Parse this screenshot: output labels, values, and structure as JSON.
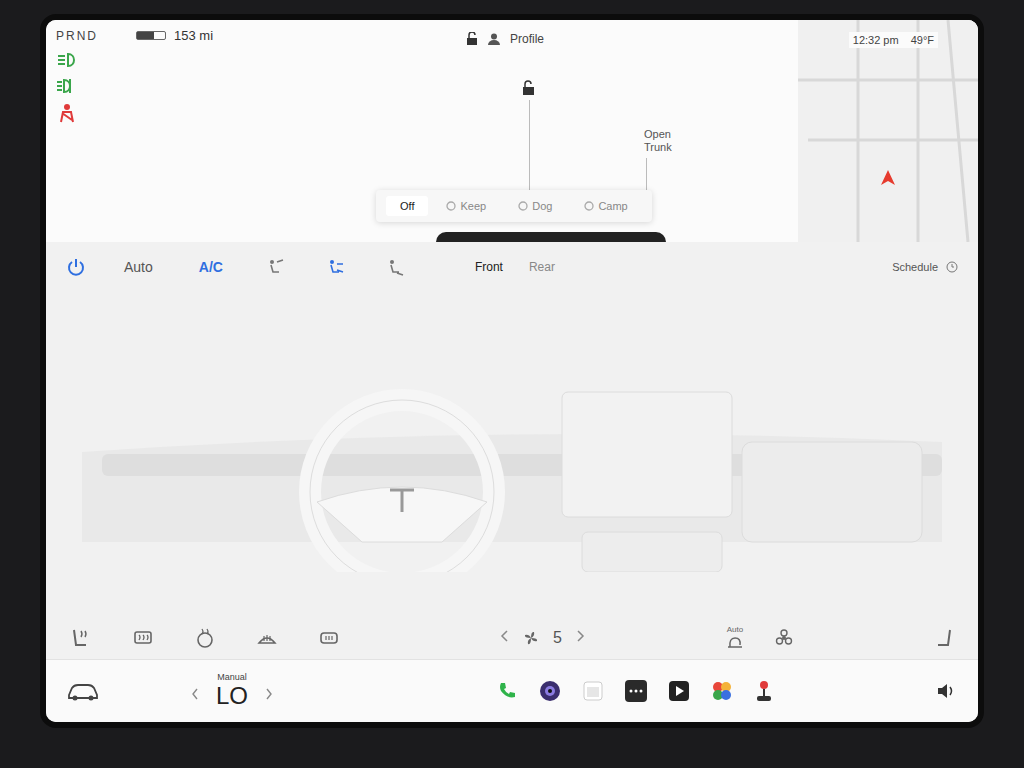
{
  "status": {
    "gear": "PRND",
    "range": "153 mi",
    "battery_level": 0.6,
    "time": "12:32 pm",
    "temperature": "49°F"
  },
  "profile": {
    "label": "Profile",
    "locked": false
  },
  "map": {
    "label": "Open Trunk"
  },
  "climate_keeper": [
    {
      "label": "Off",
      "selected": true
    },
    {
      "label": "Keep",
      "selected": false
    },
    {
      "label": "Dog",
      "selected": false
    },
    {
      "label": "Camp",
      "selected": false
    }
  ],
  "toolbar": {
    "power_on": true,
    "auto": {
      "label": "Auto",
      "on": false
    },
    "ac": {
      "label": "A/C",
      "on": true
    },
    "airflow": [
      {
        "selected": false
      },
      {
        "selected": true
      },
      {
        "selected": false
      }
    ],
    "zones": [
      {
        "label": "Front",
        "selected": true
      },
      {
        "label": "Rear",
        "selected": false
      }
    ],
    "schedule": "Schedule"
  },
  "fan": {
    "speed": "5",
    "auto_label": "Auto"
  },
  "cabin_temp": {
    "mode": "Manual",
    "value": "LO"
  }
}
